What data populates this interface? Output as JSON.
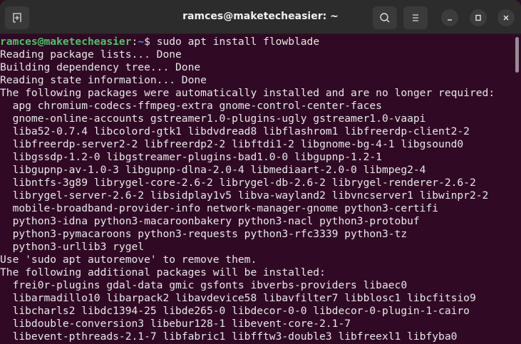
{
  "window": {
    "title": "ramces@maketecheasier: ~"
  },
  "prompt": {
    "user": "ramces@maketecheasier",
    "sep": ":",
    "path": "~",
    "symbol": "$ ",
    "command": "sudo apt install flowblade"
  },
  "lines": [
    "Reading package lists... Done",
    "Building dependency tree... Done",
    "Reading state information... Done",
    "The following packages were automatically installed and are no longer required:",
    "  apg chromium-codecs-ffmpeg-extra gnome-control-center-faces",
    "  gnome-online-accounts gstreamer1.0-plugins-ugly gstreamer1.0-vaapi",
    "  liba52-0.7.4 libcolord-gtk1 libdvdread8 libflashrom1 libfreerdp-client2-2",
    "  libfreerdp-server2-2 libfreerdp2-2 libftdi1-2 libgnome-bg-4-1 libgsound0",
    "  libgssdp-1.2-0 libgstreamer-plugins-bad1.0-0 libgupnp-1.2-1",
    "  libgupnp-av-1.0-3 libgupnp-dlna-2.0-4 libmediaart-2.0-0 libmpeg2-4",
    "  libntfs-3g89 librygel-core-2.6-2 librygel-db-2.6-2 librygel-renderer-2.6-2",
    "  librygel-server-2.6-2 libsidplay1v5 libva-wayland2 libvncserver1 libwinpr2-2",
    "  mobile-broadband-provider-info network-manager-gnome python3-certifi",
    "  python3-idna python3-macaroonbakery python3-nacl python3-protobuf",
    "  python3-pymacaroons python3-requests python3-rfc3339 python3-tz",
    "  python3-urllib3 rygel",
    "Use 'sudo apt autoremove' to remove them.",
    "The following additional packages will be installed:",
    "  frei0r-plugins gdal-data gmic gsfonts ibverbs-providers libaec0",
    "  libarmadillo10 libarpack2 libavdevice58 libavfilter7 libblosc1 libcfitsio9",
    "  libcharls2 libdc1394-25 libde265-0 libdecor-0-0 libdecor-0-plugin-1-cairo",
    "  libdouble-conversion3 libebur128-1 libevent-core-2.1-7",
    "  libevent-pthreads-2.1-7 libfabric1 libfftw3-double3 libfreexl1 libfyba0"
  ]
}
